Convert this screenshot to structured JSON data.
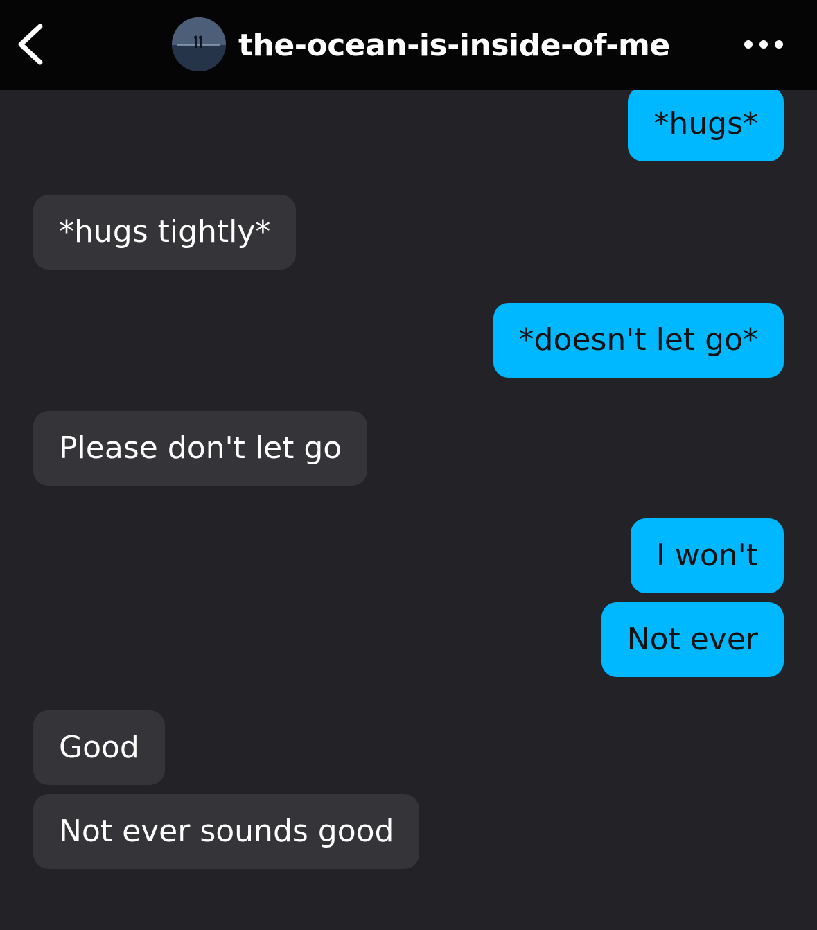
{
  "header": {
    "username": "the-ocean-is-inside-of-me",
    "back_icon": "chevron-left-icon",
    "more_icon": "more-horizontal-icon",
    "avatar_desc": "avatar"
  },
  "colors": {
    "header_bg": "#050505",
    "chat_bg": "#232226",
    "sent_bubble": "#00b8ff",
    "received_bubble": "#353438"
  },
  "messages": [
    {
      "from": "me",
      "text": "*hugs*"
    },
    {
      "from": "them",
      "text": "*hugs tightly*"
    },
    {
      "from": "me",
      "text": "*doesn't let go*"
    },
    {
      "from": "them",
      "text": "Please don't let go"
    },
    {
      "from": "me",
      "text": "I won't"
    },
    {
      "from": "me",
      "text": "Not ever"
    },
    {
      "from": "them",
      "text": "Good"
    },
    {
      "from": "them",
      "text": "Not ever sounds good"
    }
  ]
}
